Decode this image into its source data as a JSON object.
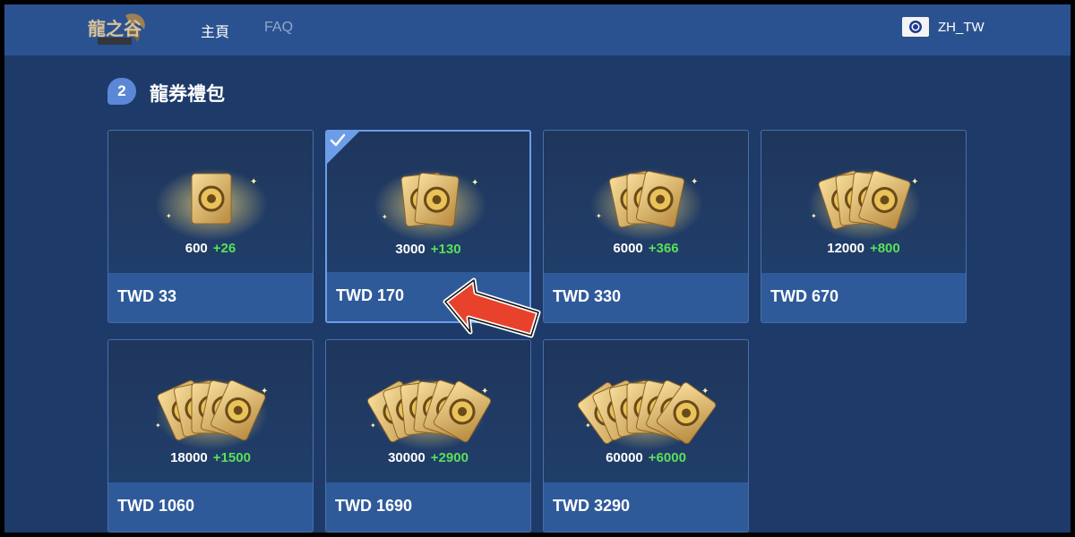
{
  "header": {
    "logo_name": "dragon-logo",
    "nav": [
      {
        "label": "主頁"
      },
      {
        "label": "FAQ"
      }
    ],
    "language": "ZH_TW"
  },
  "section": {
    "number": "2",
    "title": "龍券禮包"
  },
  "packages": [
    {
      "amount": "600",
      "bonus": "+26",
      "price": "TWD 33",
      "selected": false
    },
    {
      "amount": "3000",
      "bonus": "+130",
      "price": "TWD 170",
      "selected": true
    },
    {
      "amount": "6000",
      "bonus": "+366",
      "price": "TWD 330",
      "selected": false
    },
    {
      "amount": "12000",
      "bonus": "+800",
      "price": "TWD 670",
      "selected": false
    },
    {
      "amount": "18000",
      "bonus": "+1500",
      "price": "TWD 1060",
      "selected": false
    },
    {
      "amount": "30000",
      "bonus": "+2900",
      "price": "TWD 1690",
      "selected": false
    },
    {
      "amount": "60000",
      "bonus": "+6000",
      "price": "TWD 3290",
      "selected": false
    }
  ],
  "colors": {
    "background": "#1d3a69",
    "topbar": "#2b5290",
    "accent": "#6c9de8",
    "bonus": "#59e05a",
    "arrow": "#e8412c"
  },
  "icons": {
    "selected": "checkmark-icon",
    "pointer": "red-arrow-annotation",
    "item": "dragon-coupon-stack-icon"
  }
}
